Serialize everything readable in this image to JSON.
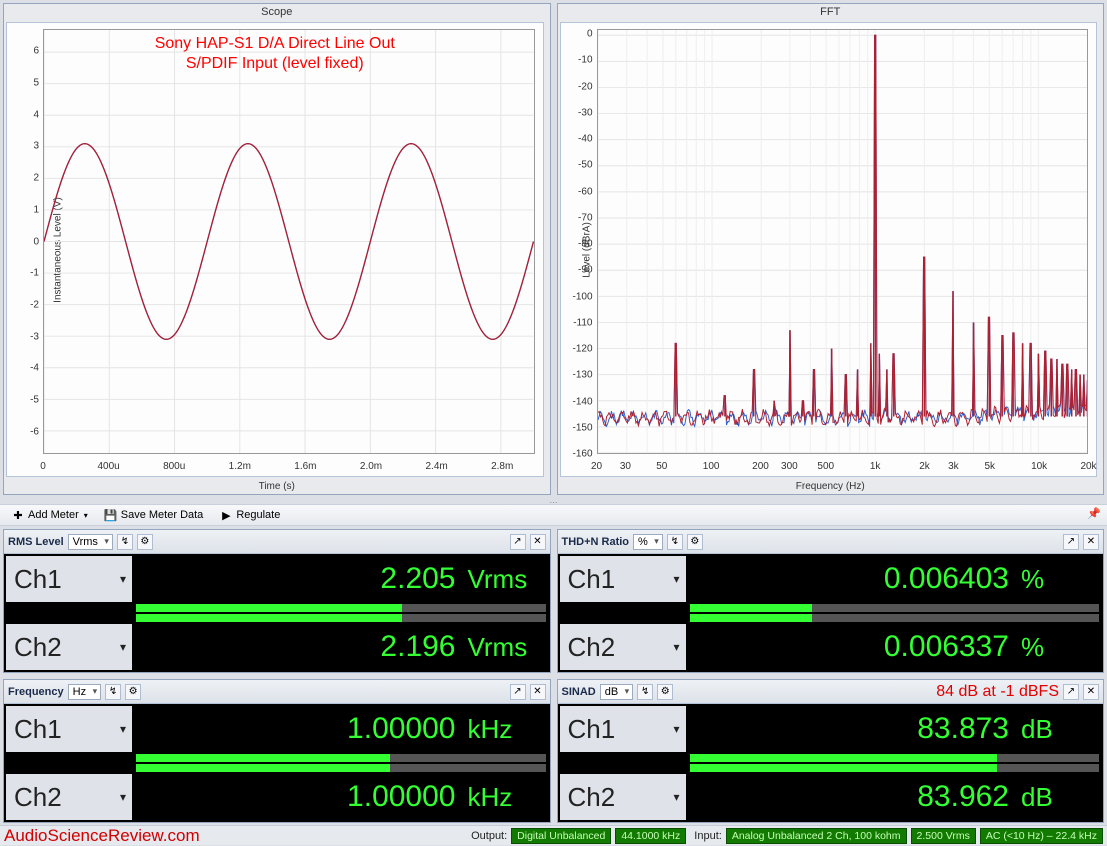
{
  "annotations": {
    "scope_line1": "Sony HAP-S1 D/A Direct Line Out",
    "scope_line2": "S/PDIF Input (level fixed)",
    "sinad_note": "84 dB at -1 dBFS"
  },
  "toolbar": {
    "add_meter": "Add Meter",
    "save_meter": "Save Meter Data",
    "regulate": "Regulate"
  },
  "meters": [
    {
      "id": "rms",
      "title": "RMS Level",
      "unit": "Vrms",
      "ch1": {
        "val": "2.205",
        "un": "Vrms",
        "fill": 65
      },
      "ch2": {
        "val": "2.196",
        "un": "Vrms",
        "fill": 65
      }
    },
    {
      "id": "thdn",
      "title": "THD+N Ratio",
      "unit": "%",
      "ch1": {
        "val": "0.006403",
        "un": "%",
        "fill": 30
      },
      "ch2": {
        "val": "0.006337",
        "un": "%",
        "fill": 30
      }
    },
    {
      "id": "freq",
      "title": "Frequency",
      "unit": "Hz",
      "ch1": {
        "val": "1.00000",
        "un": "kHz",
        "fill": 62
      },
      "ch2": {
        "val": "1.00000",
        "un": "kHz",
        "fill": 62
      }
    },
    {
      "id": "sinad",
      "title": "SINAD",
      "unit": "dB",
      "ch1": {
        "val": "83.873",
        "un": "dB",
        "fill": 75
      },
      "ch2": {
        "val": "83.962",
        "un": "dB",
        "fill": 75
      },
      "annot": "sinad"
    }
  ],
  "statusbar": {
    "brand": "AudioScienceReview.com",
    "output_label": "Output:",
    "output_type": "Digital Unbalanced",
    "output_rate": "44.1000 kHz",
    "input_label": "Input:",
    "input_type": "Analog Unbalanced 2 Ch, 100 kohm",
    "input_range": "2.500 Vrms",
    "input_bw": "AC (<10 Hz) – 22.4 kHz"
  },
  "chart_data": [
    {
      "id": "scope",
      "type": "line",
      "title": "Scope",
      "xlabel": "Time (s)",
      "ylabel": "Instantaneous Level (V)",
      "xticks": [
        "0",
        "400u",
        "800u",
        "1.2m",
        "1.6m",
        "2.0m",
        "2.4m",
        "2.8m"
      ],
      "yticks": [
        -6,
        -5,
        -4,
        -3,
        -2,
        -1,
        0,
        1,
        2,
        3,
        4,
        5,
        6
      ],
      "ylim": [
        -6.7,
        6.7
      ],
      "xlim": [
        0,
        0.003
      ],
      "series": [
        {
          "name": "Ch1",
          "color": "#2a5fd0",
          "amp": 3.1,
          "freq": 1000,
          "phase": 0
        },
        {
          "name": "Ch2",
          "color": "#b01f2e",
          "amp": 3.1,
          "freq": 1000,
          "phase": 0
        }
      ]
    },
    {
      "id": "fft",
      "type": "line",
      "title": "FFT",
      "xlabel": "Frequency (Hz)",
      "ylabel": "Level (dBrA)",
      "xscale": "log",
      "xlim": [
        20,
        20000
      ],
      "ylim": [
        -160,
        2
      ],
      "xticks": [
        20,
        30,
        50,
        100,
        200,
        300,
        500,
        "1k",
        "2k",
        "3k",
        "5k",
        "10k",
        "20k"
      ],
      "yticks": [
        0,
        -10,
        -20,
        -30,
        -40,
        -50,
        -60,
        -70,
        -80,
        -90,
        -100,
        -110,
        -120,
        -130,
        -140,
        -150,
        -160
      ],
      "noise_floor": -148,
      "peaks": [
        {
          "f": 60,
          "db": -118
        },
        {
          "f": 120,
          "db": -138
        },
        {
          "f": 180,
          "db": -128
        },
        {
          "f": 240,
          "db": -140
        },
        {
          "f": 300,
          "db": -113
        },
        {
          "f": 360,
          "db": -140
        },
        {
          "f": 420,
          "db": -128
        },
        {
          "f": 540,
          "db": -120
        },
        {
          "f": 660,
          "db": -130
        },
        {
          "f": 780,
          "db": -128
        },
        {
          "f": 940,
          "db": -118
        },
        {
          "f": 1000,
          "db": 0
        },
        {
          "f": 1060,
          "db": -122
        },
        {
          "f": 1180,
          "db": -128
        },
        {
          "f": 1300,
          "db": -122
        },
        {
          "f": 2000,
          "db": -85
        },
        {
          "f": 3000,
          "db": -98
        },
        {
          "f": 4000,
          "db": -110
        },
        {
          "f": 5000,
          "db": -108
        },
        {
          "f": 6000,
          "db": -115
        },
        {
          "f": 7000,
          "db": -114
        },
        {
          "f": 8000,
          "db": -118
        },
        {
          "f": 9000,
          "db": -118
        },
        {
          "f": 10000,
          "db": -122
        },
        {
          "f": 11000,
          "db": -121
        },
        {
          "f": 12000,
          "db": -124
        },
        {
          "f": 13000,
          "db": -124
        },
        {
          "f": 14000,
          "db": -126
        },
        {
          "f": 15000,
          "db": -126
        },
        {
          "f": 16000,
          "db": -128
        },
        {
          "f": 17000,
          "db": -128
        },
        {
          "f": 18000,
          "db": -130
        },
        {
          "f": 19000,
          "db": -130
        },
        {
          "f": 20000,
          "db": -132
        }
      ]
    }
  ]
}
